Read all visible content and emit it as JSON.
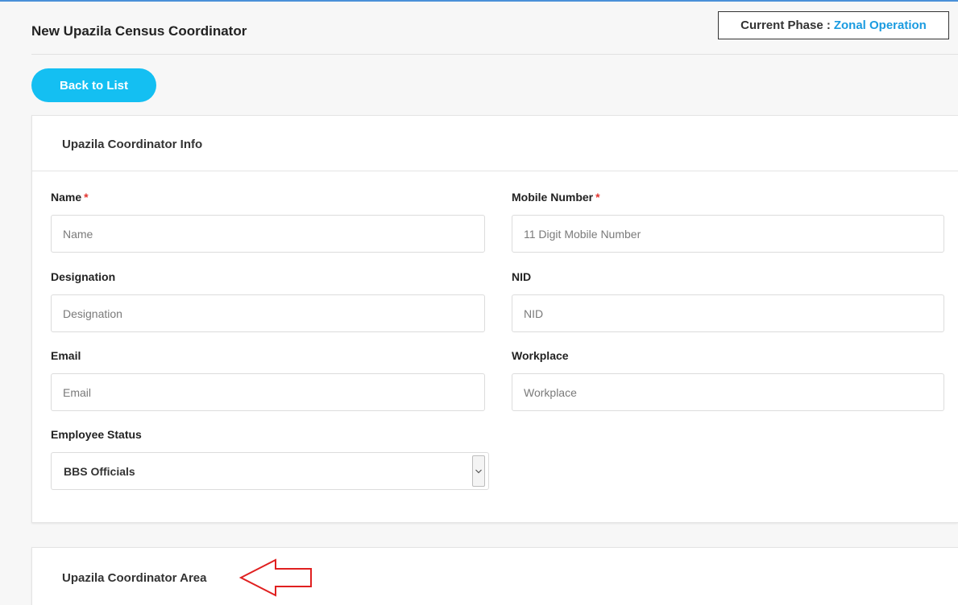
{
  "header": {
    "title": "New Upazila Census Coordinator",
    "phase_label": "Current Phase :",
    "phase_value": "Zonal Operation"
  },
  "back_button": {
    "label": "Back to List"
  },
  "info_card": {
    "title": "Upazila Coordinator Info",
    "fields": {
      "name": {
        "label": "Name",
        "required_mark": "*",
        "placeholder": "Name",
        "value": ""
      },
      "mobile": {
        "label": "Mobile Number",
        "required_mark": "*",
        "placeholder": "11 Digit Mobile Number",
        "value": ""
      },
      "designation": {
        "label": "Designation",
        "placeholder": "Designation",
        "value": ""
      },
      "nid": {
        "label": "NID",
        "placeholder": "NID",
        "value": ""
      },
      "email": {
        "label": "Email",
        "placeholder": "Email",
        "value": ""
      },
      "workplace": {
        "label": "Workplace",
        "placeholder": "Workplace",
        "value": ""
      },
      "employee_status": {
        "label": "Employee Status",
        "selected": "BBS Officials"
      }
    }
  },
  "area_card": {
    "title": "Upazila Coordinator Area"
  },
  "colors": {
    "accent": "#14bff2",
    "phase_value": "#1a9be0",
    "required": "#e3342f",
    "annotation_arrow": "#e02020"
  }
}
